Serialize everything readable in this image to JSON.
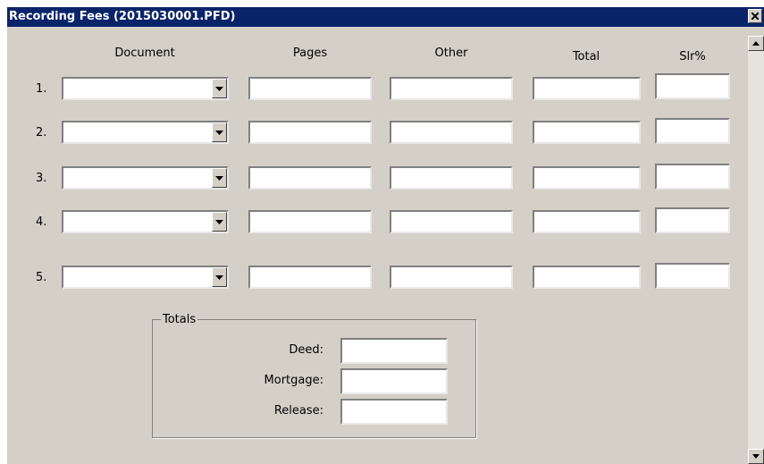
{
  "window": {
    "title": "Recording Fees (2015030001.PFD)",
    "close_icon": "close-icon"
  },
  "columns": {
    "document": "Document",
    "pages": "Pages",
    "other": "Other",
    "total": "Total",
    "slr": "Slr%"
  },
  "rows": [
    {
      "number": "1.",
      "document": "",
      "pages": "",
      "other": "",
      "total": "",
      "slr": ""
    },
    {
      "number": "2.",
      "document": "",
      "pages": "",
      "other": "",
      "total": "",
      "slr": ""
    },
    {
      "number": "3.",
      "document": "",
      "pages": "",
      "other": "",
      "total": "",
      "slr": ""
    },
    {
      "number": "4.",
      "document": "",
      "pages": "",
      "other": "",
      "total": "",
      "slr": ""
    },
    {
      "number": "5.",
      "document": "",
      "pages": "",
      "other": "",
      "total": "",
      "slr": ""
    }
  ],
  "totals": {
    "legend": "Totals",
    "deed_label": "Deed:",
    "deed": "",
    "mortgage_label": "Mortgage:",
    "mortgage": "",
    "release_label": "Release:",
    "release": ""
  }
}
